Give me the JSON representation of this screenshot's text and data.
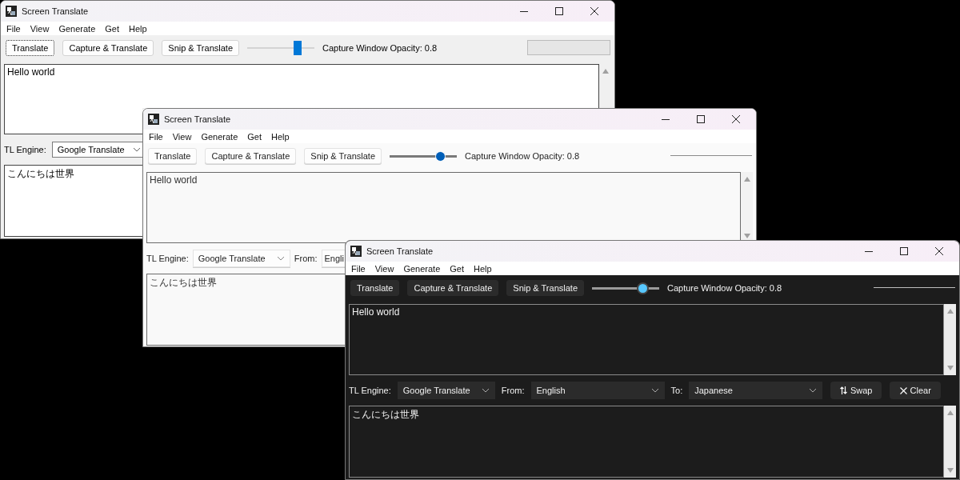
{
  "windows": [
    {
      "kind": "classic",
      "title": "Screen Translate",
      "menu": [
        "File",
        "View",
        "Generate",
        "Get",
        "Help"
      ],
      "toolbar": {
        "buttons": [
          {
            "label": "Translate",
            "focused": true
          },
          {
            "label": "Capture & Translate",
            "focused": false
          },
          {
            "label": "Snip & Translate",
            "focused": false
          }
        ],
        "slider": {
          "level": 0.75
        },
        "opacity_label": "Capture Window Opacity: 0.8",
        "progress": {
          "level": 0
        }
      },
      "source_text": "Hello world",
      "controls": [
        {
          "kind": "label",
          "text": "TL Engine:"
        },
        {
          "kind": "dropdown",
          "value": "Google Translate"
        }
      ],
      "result_text": "こんにちは世界"
    },
    {
      "kind": "light",
      "title": "Screen Translate",
      "menu": [
        "File",
        "View",
        "Generate",
        "Get",
        "Help"
      ],
      "toolbar": {
        "buttons": [
          {
            "label": "Translate",
            "focused": false
          },
          {
            "label": "Capture & Translate",
            "focused": false
          },
          {
            "label": "Snip & Translate",
            "focused": false
          }
        ],
        "slider": {
          "level": 0.75
        },
        "opacity_label": "Capture Window Opacity: 0.8",
        "progress": {
          "level": 0
        }
      },
      "source_text": "Hello world",
      "controls": [
        {
          "kind": "label",
          "text": "TL Engine:"
        },
        {
          "kind": "dropdown",
          "value": "Google Translate"
        },
        {
          "kind": "label",
          "text": "From:"
        },
        {
          "kind": "dropdown",
          "value": "Engli"
        }
      ],
      "result_text": "こんにちは世界"
    },
    {
      "kind": "dark",
      "title": "Screen Translate",
      "menu": [
        "File",
        "View",
        "Generate",
        "Get",
        "Help"
      ],
      "toolbar": {
        "buttons": [
          {
            "label": "Translate",
            "focused": false
          },
          {
            "label": "Capture & Translate",
            "focused": false
          },
          {
            "label": "Snip & Translate",
            "focused": false
          }
        ],
        "slider": {
          "level": 0.75
        },
        "opacity_label": "Capture Window Opacity: 0.8",
        "progress": {
          "level": 0
        }
      },
      "source_text": "Hello world",
      "controls": [
        {
          "kind": "label",
          "text": "TL Engine:"
        },
        {
          "kind": "dropdown",
          "value": "Google Translate"
        },
        {
          "kind": "label",
          "text": "From:"
        },
        {
          "kind": "dropdown",
          "value": "English"
        },
        {
          "kind": "label",
          "text": "To:"
        },
        {
          "kind": "dropdown",
          "value": "Japanese"
        },
        {
          "kind": "swap",
          "label": "Swap"
        },
        {
          "kind": "clear",
          "label": "Clear"
        }
      ],
      "result_text": "こんにちは世界"
    }
  ]
}
